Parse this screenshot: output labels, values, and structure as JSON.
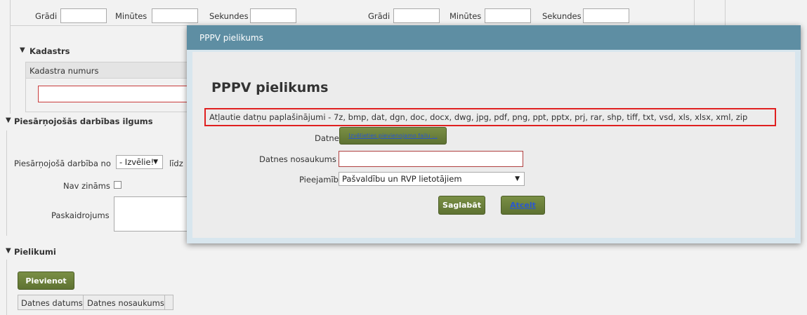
{
  "coords": {
    "labels": [
      "Grādi",
      "Minūtes",
      "Sekundes",
      "Grādi",
      "Minūtes",
      "Sekundes"
    ]
  },
  "kadastrs": {
    "title": "Kadastrs",
    "column_header": "Kadastra numurs"
  },
  "duration": {
    "title": "Piesārņojošās darbības ilgums",
    "from_label": "Piesārņojošā darbība no",
    "from_select": "- Izvēlie!",
    "to_label": "līdz",
    "unknown_label": "Nav zināms",
    "explanation_label": "Paskaidrojums"
  },
  "attachments": {
    "title": "Pielikumi",
    "add_button": "Pievienot",
    "columns": [
      "Datnes datums",
      "Datnes nosaukums"
    ]
  },
  "dialog": {
    "window_title": "PPPV pielikums",
    "heading": "PPPV pielikums",
    "allowed_extensions": "Atļautie datņu paplašinājumi - 7z, bmp, dat, dgn, doc, docx, dwg, jpg, pdf, png, ppt, pptx, prj, rar, shp, tiff, txt, vsd, xls, xlsx, xml, zip",
    "file_label": "Datne",
    "choose_file_button": "Izvēlieties pievienojamo failu ...",
    "filename_label": "Datnes nosaukums",
    "filename_value": "",
    "access_label": "Pieejamība",
    "access_value": "Pašvaldību un RVP lietotājiem",
    "save_button": "Saglabāt",
    "cancel_button": "Atcelt"
  },
  "colors": {
    "titlebar": "#5e8ea3",
    "highlight": "#e02020",
    "button": "#667a38"
  }
}
